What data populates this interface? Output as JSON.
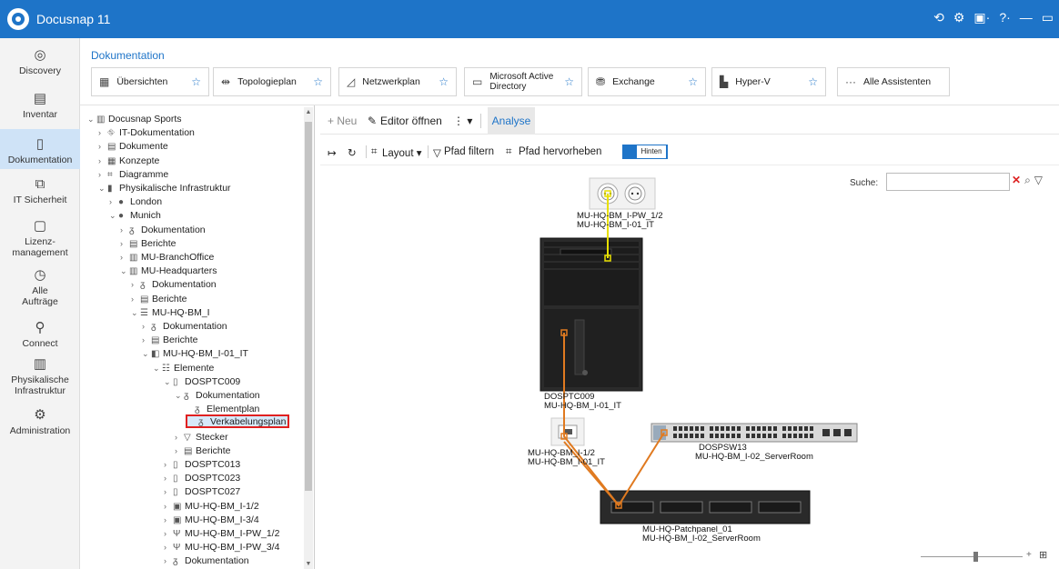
{
  "app": {
    "title": "Docusnap 11"
  },
  "titlebar_icons": [
    "help-cycle-icon",
    "gear-icon",
    "user-icon",
    "question-icon",
    "minimize-icon",
    "maximize-icon"
  ],
  "titlebar_glyphs": {
    "help": "⟲",
    "settings": "⚙",
    "user": "▣·",
    "question": "?·",
    "minimize": "—",
    "maximize": "▭"
  },
  "nav": [
    {
      "label": "Discovery",
      "icon": "globe-icon",
      "glyph": "◎"
    },
    {
      "label": "Inventar",
      "icon": "inventory-icon",
      "glyph": "▤"
    },
    {
      "label": "Dokumentation",
      "icon": "documentation-icon",
      "glyph": "▯"
    },
    {
      "label": "IT Sicherheit",
      "icon": "security-icon",
      "glyph": "⧉"
    },
    {
      "label_line1": "Lizenz-",
      "label_line2": "management",
      "icon": "license-icon",
      "glyph": "▢"
    },
    {
      "label_line1": "Alle",
      "label_line2": "Aufträge",
      "icon": "clock-icon",
      "glyph": "◷"
    },
    {
      "label": "Connect",
      "icon": "connect-icon",
      "glyph": "⚲"
    },
    {
      "label_line1": "Physikalische",
      "label_line2": "Infrastruktur",
      "icon": "rack-icon",
      "glyph": "▥"
    },
    {
      "label": "Administration",
      "icon": "admin-gears-icon",
      "glyph": "⚙"
    }
  ],
  "ribbon": {
    "section_title": "Dokumentation",
    "buttons": [
      {
        "label": "Übersichten",
        "icon": "table-icon",
        "glyph": "▦"
      },
      {
        "label": "Topologieplan",
        "icon": "topology-icon",
        "glyph": "⇹"
      },
      {
        "label": "Netzwerkplan",
        "icon": "network-icon",
        "glyph": "◿"
      },
      {
        "label_line1": "Microsoft Active",
        "label_line2": "Directory",
        "icon": "ad-icon",
        "glyph": "▭"
      },
      {
        "label": "Exchange",
        "icon": "exchange-icon",
        "glyph": "⛃"
      },
      {
        "label": "Hyper-V",
        "icon": "hyperv-icon",
        "glyph": "▙"
      },
      {
        "label": "Alle Assistenten",
        "icon": "more-icon",
        "glyph": "···"
      }
    ],
    "star": "☆"
  },
  "tree": {
    "items": [
      {
        "label": "Docusnap Sports",
        "chev": "⌄",
        "glyph": "▥",
        "icon": "company-icon"
      },
      {
        "label": "IT-Dokumentation",
        "chev": "›",
        "glyph": "⛗",
        "icon": "it-doc-icon"
      },
      {
        "label": "Dokumente",
        "chev": "›",
        "glyph": "▤",
        "icon": "documents-icon"
      },
      {
        "label": "Konzepte",
        "chev": "›",
        "glyph": "▦",
        "icon": "concepts-icon"
      },
      {
        "label": "Diagramme",
        "chev": "›",
        "glyph": "⌗",
        "icon": "diagram-icon"
      },
      {
        "label": "Physikalische Infrastruktur",
        "chev": "⌄",
        "glyph": "▮",
        "icon": "rack-icon"
      },
      {
        "label": "London",
        "chev": "›",
        "glyph": "●",
        "icon": "location-icon"
      },
      {
        "label": "Munich",
        "chev": "⌄",
        "glyph": "●",
        "icon": "location-icon"
      },
      {
        "label": "Dokumentation",
        "chev": "›",
        "glyph": "ᵹ",
        "icon": "doc-tree-icon"
      },
      {
        "label": "Berichte",
        "chev": "›",
        "glyph": "▤",
        "icon": "report-icon"
      },
      {
        "label": "MU-BranchOffice",
        "chev": "›",
        "glyph": "▥",
        "icon": "building-icon"
      },
      {
        "label": "MU-Headquarters",
        "chev": "⌄",
        "glyph": "▥",
        "icon": "building-icon"
      },
      {
        "label": "Dokumentation",
        "chev": "›",
        "glyph": "ᵹ",
        "icon": "doc-tree-icon"
      },
      {
        "label": "Berichte",
        "chev": "›",
        "glyph": "▤",
        "icon": "report-icon"
      },
      {
        "label": "MU-HQ-BM_I",
        "chev": "⌄",
        "glyph": "☰",
        "icon": "room-icon"
      },
      {
        "label": "Dokumentation",
        "chev": "›",
        "glyph": "ᵹ",
        "icon": "doc-tree-icon"
      },
      {
        "label": "Berichte",
        "chev": "›",
        "glyph": "▤",
        "icon": "report-icon"
      },
      {
        "label": "MU-HQ-BM_I-01_IT",
        "chev": "⌄",
        "glyph": "◧",
        "icon": "workplace-icon"
      },
      {
        "label": "Elemente",
        "chev": "⌄",
        "glyph": "☷",
        "icon": "elements-icon"
      },
      {
        "label": "DOSPTC009",
        "chev": "⌄",
        "glyph": "▯",
        "icon": "pc-icon"
      },
      {
        "label": "Dokumentation",
        "chev": "⌄",
        "glyph": "ᵹ",
        "icon": "doc-tree-icon"
      },
      {
        "label": "Elementplan",
        "chev": "",
        "glyph": "ᵹ",
        "icon": "plan-icon"
      },
      {
        "label": "Verkabelungsplan",
        "chev": "",
        "glyph": "ᵹ",
        "icon": "plan-icon"
      },
      {
        "label": "Stecker",
        "chev": "›",
        "glyph": "▽",
        "icon": "plug-icon"
      },
      {
        "label": "Berichte",
        "chev": "›",
        "glyph": "▤",
        "icon": "report-icon"
      },
      {
        "label": "DOSPTC013",
        "chev": "›",
        "glyph": "▯",
        "icon": "pc-icon"
      },
      {
        "label": "DOSPTC023",
        "chev": "›",
        "glyph": "▯",
        "icon": "pc-icon"
      },
      {
        "label": "DOSPTC027",
        "chev": "›",
        "glyph": "▯",
        "icon": "pc-icon"
      },
      {
        "label": "MU-HQ-BM_I-1/2",
        "chev": "›",
        "glyph": "▣",
        "icon": "socket-icon"
      },
      {
        "label": "MU-HQ-BM_I-3/4",
        "chev": "›",
        "glyph": "▣",
        "icon": "socket-icon"
      },
      {
        "label": "MU-HQ-BM_I-PW_1/2",
        "chev": "›",
        "glyph": "Ψ",
        "icon": "power-socket-icon"
      },
      {
        "label": "MU-HQ-BM_I-PW_3/4",
        "chev": "›",
        "glyph": "Ψ",
        "icon": "power-socket-icon"
      },
      {
        "label": "Dokumentation",
        "chev": "›",
        "glyph": "ᵹ",
        "icon": "doc-tree-icon"
      }
    ]
  },
  "toolbar1": {
    "new_label": "+ Neu",
    "editor_label": "Editor öffnen",
    "editor_glyph": "✎",
    "more_glyph": "⋮ ▾",
    "analyse_label": "Analyse"
  },
  "toolbar2": {
    "arrow_glyph": "↦",
    "refresh_glyph": "↻",
    "layout_label": "Layout ▾",
    "layout_glyph": "⌗",
    "filter_label": "Pfad filtern",
    "filter_glyph": "▽",
    "highlight_label": "Pfad hervorheben",
    "highlight_glyph": "⌗",
    "toggle_label": "Hinten"
  },
  "search": {
    "label": "Suche:",
    "value": "",
    "clear": "✕",
    "find": "⌕",
    "filter": "▽"
  },
  "diagram": {
    "power_socket": {
      "name": "MU-HQ-BM_I-PW_1/2",
      "location": "MU-HQ-BM_I-01_IT"
    },
    "pc": {
      "name": "DOSPTC009",
      "location": "MU-HQ-BM_I-01_IT"
    },
    "data_socket": {
      "name": "MU-HQ-BM_I-1/2",
      "location": "MU-HQ-BM_I-01_IT"
    },
    "switch": {
      "name": "DOSPSW13",
      "location": "MU-HQ-BM_I-02_ServerRoom"
    },
    "patchpanel": {
      "name": "MU-HQ-Patchpanel_01",
      "location": "MU-HQ-BM_I-02_ServerRoom"
    },
    "power_cable_color": "#e8e000",
    "network_cable_color": "#e07a20"
  },
  "zoom": {
    "plus": "+",
    "fit_glyph": "⊞"
  },
  "colors": {
    "accent": "#1e74c8",
    "selected_border": "#e02020"
  }
}
